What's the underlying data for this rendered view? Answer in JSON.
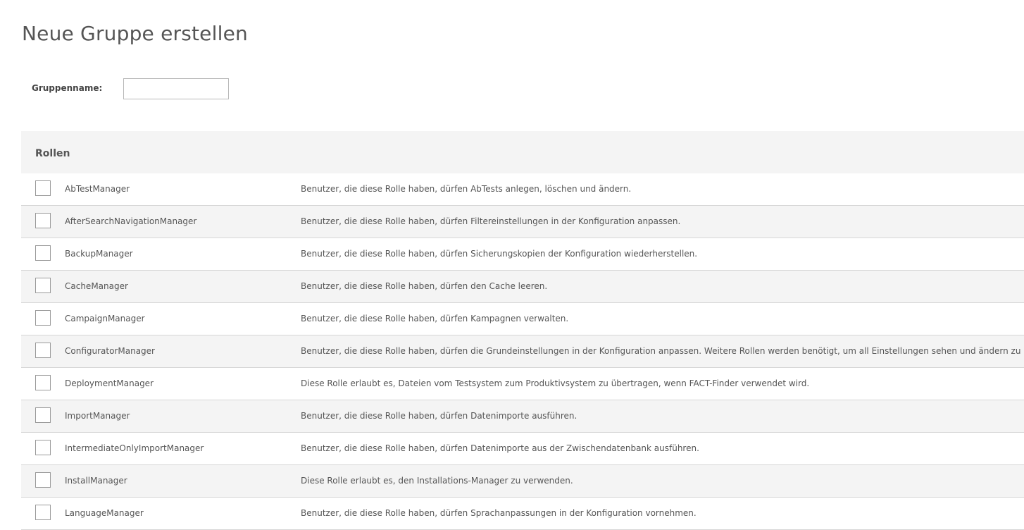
{
  "page": {
    "title": "Neue Gruppe erstellen"
  },
  "form": {
    "group_name_label": "Gruppenname:",
    "group_name_value": "",
    "group_name_placeholder": ""
  },
  "roles": {
    "header": "Rollen",
    "items": [
      {
        "name": "AbTestManager",
        "description": "Benutzer, die diese Rolle haben, dürfen AbTests anlegen, löschen und ändern.",
        "checked": false
      },
      {
        "name": "AfterSearchNavigationManager",
        "description": "Benutzer, die diese Rolle haben, dürfen Filtereinstellungen in der Konfiguration anpassen.",
        "checked": false
      },
      {
        "name": "BackupManager",
        "description": "Benutzer, die diese Rolle haben, dürfen Sicherungskopien der Konfiguration wiederherstellen.",
        "checked": false
      },
      {
        "name": "CacheManager",
        "description": "Benutzer, die diese Rolle haben, dürfen den Cache leeren.",
        "checked": false
      },
      {
        "name": "CampaignManager",
        "description": "Benutzer, die diese Rolle haben, dürfen Kampagnen verwalten.",
        "checked": false
      },
      {
        "name": "ConfiguratorManager",
        "description": "Benutzer, die diese Rolle haben, dürfen die Grundeinstellungen in der Konfiguration anpassen. Weitere Rollen werden benötigt, um all Einstellungen sehen und ändern zu können.",
        "checked": false
      },
      {
        "name": "DeploymentManager",
        "description": "Diese Rolle erlaubt es, Dateien vom Testsystem zum Produktivsystem zu übertragen, wenn FACT-Finder verwendet wird.",
        "checked": false
      },
      {
        "name": "ImportManager",
        "description": "Benutzer, die diese Rolle haben, dürfen Datenimporte ausführen.",
        "checked": false
      },
      {
        "name": "IntermediateOnlyImportManager",
        "description": "Benutzer, die diese Rolle haben, dürfen Datenimporte aus der Zwischendatenbank ausführen.",
        "checked": false
      },
      {
        "name": "InstallManager",
        "description": "Diese Rolle erlaubt es, den Installations-Manager zu verwenden.",
        "checked": false
      },
      {
        "name": "LanguageManager",
        "description": "Benutzer, die diese Rolle haben, dürfen Sprachanpassungen in der Konfiguration vornehmen.",
        "checked": false
      }
    ]
  },
  "colors": {
    "text": "#555555",
    "row_alt_background": "#f4f4f4",
    "divider": "#d6d6d6"
  }
}
